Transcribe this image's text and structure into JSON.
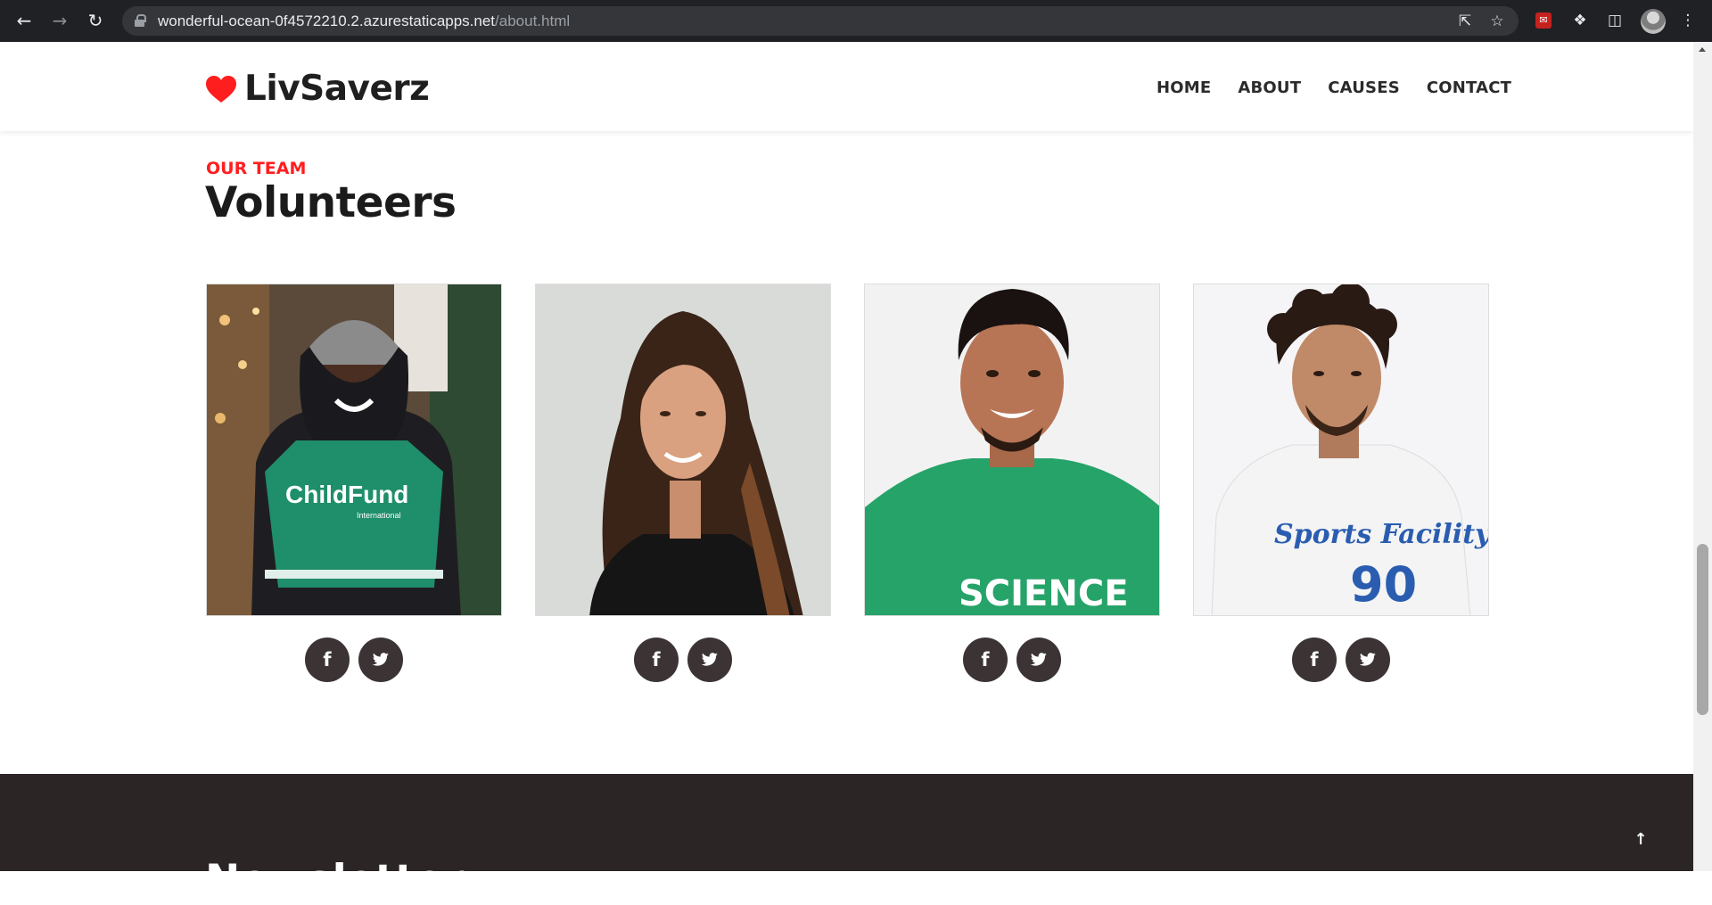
{
  "browser": {
    "url_host": "wonderful-ocean-0f4572210.2.azurestaticapps.net",
    "url_path": "/about.html",
    "icons": [
      "back-icon",
      "forward-icon",
      "reload-icon",
      "lock-icon",
      "share-icon",
      "bookmark-star-icon",
      "extension-icon",
      "puzzle-icon",
      "side-panel-icon",
      "profile-avatar",
      "menu-kebab-icon"
    ]
  },
  "header": {
    "brand": "LivSaverz",
    "brand_color": "#ff1e1e",
    "nav": [
      "HOME",
      "ABOUT",
      "CAUSES",
      "CONTACT"
    ]
  },
  "team": {
    "eyebrow": "OUR TEAM",
    "title": "Volunteers",
    "accent": "#ff1e1e",
    "members": [
      {
        "photo": "volunteer in green ChildFund vest",
        "photo_text": "ChildFund",
        "photo_subtext": "International",
        "social": [
          "f",
          "twitter"
        ]
      },
      {
        "photo": "woman with long brown hair in black top",
        "photo_text": "",
        "photo_subtext": "",
        "social": [
          "f",
          "twitter"
        ]
      },
      {
        "photo": "smiling man in green SCIENCE t-shirt",
        "photo_text": "SCIENCE",
        "photo_subtext": "",
        "social": [
          "f",
          "twitter"
        ]
      },
      {
        "photo": "man with curly hair in white Sports Facility t-shirt",
        "photo_text": "Sports Facility",
        "photo_subtext": "90",
        "social": [
          "f",
          "twitter"
        ]
      }
    ]
  },
  "footer": {
    "heading_partial": "Newsletter",
    "bg": "#2b2526",
    "to_top": "↑"
  }
}
